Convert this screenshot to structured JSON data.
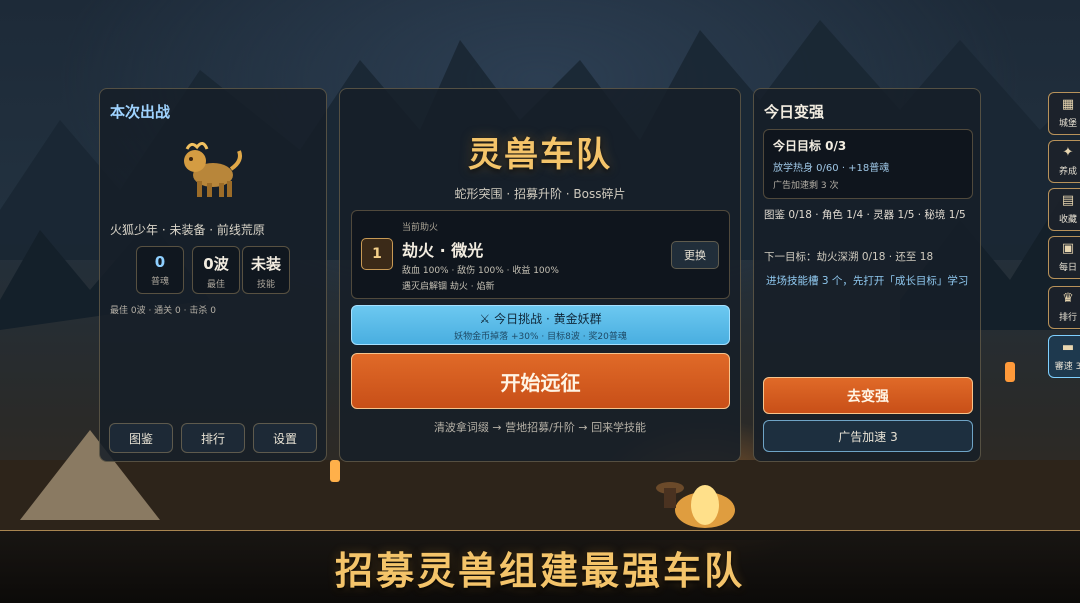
{
  "left_panel": {
    "title": "本次出战",
    "hero_line": "火狐少年 · 未装备 · 前线荒原",
    "stats": [
      {
        "value": "0",
        "label": "普魂"
      },
      {
        "value": "0波",
        "label": "最佳"
      },
      {
        "value": "未装",
        "label": "技能"
      }
    ],
    "record_line": "最佳 0波 · 通关 0 · 击杀 0",
    "buttons": [
      "图鉴",
      "排行",
      "设置"
    ]
  },
  "center_panel": {
    "title": "灵兽车队",
    "subtitle": "蛇形突围 · 招募升阶 · Boss碎片",
    "helper": {
      "caption": "当前助火",
      "level": "1",
      "name": "劫火 · 微光",
      "stats": "敌血 100% · 敌伤 100% · 收益 100%",
      "hint": "遇灭启解锢 劫火 · 焰新",
      "swap_label": "更换"
    },
    "challenge": {
      "title": "今日挑战 · 黄金妖群",
      "desc": "妖物金币掉落 +30% · 目标8波 · 奖20普魂"
    },
    "start_label": "开始远征",
    "flow_hint": "清波拿词缀 → 营地招募/升阶 → 回来学技能"
  },
  "right_panel": {
    "title": "今日变强",
    "goal": {
      "title": "今日目标 0/3",
      "line1": "放学热身 0/60 · +18普魂",
      "line2": "广告加速剩 3 次"
    },
    "progress": "图鉴 0/18 · 角色 1/4 · 灵器 1/5 · 秘境 1/5",
    "next_goal": "下一目标：劫火深溯 0/18 · 还至 18",
    "tip": "进场技能槽 3 个，先打开「成长目标」学习",
    "upgrade_label": "去变强",
    "boost_label": "广告加速 3"
  },
  "side_nav": [
    {
      "label": "城堡",
      "icon": "castle-icon",
      "glyph": "▦"
    },
    {
      "label": "养成",
      "icon": "growth-icon",
      "glyph": "✦"
    },
    {
      "label": "收藏",
      "icon": "book-icon",
      "glyph": "▤"
    },
    {
      "label": "每日",
      "icon": "calendar-icon",
      "glyph": "▣"
    },
    {
      "label": "排行",
      "icon": "trophy-icon",
      "glyph": "♛"
    },
    {
      "label": "審速 3",
      "icon": "speed-icon",
      "glyph": "▬"
    }
  ],
  "banner": "招募灵兽组建最强车队",
  "colors": {
    "gold": "#f4c46a",
    "orange_button": "#d45c20",
    "blue_button": "#5bbbe8",
    "panel_title_blue": "#9fd3ff"
  }
}
